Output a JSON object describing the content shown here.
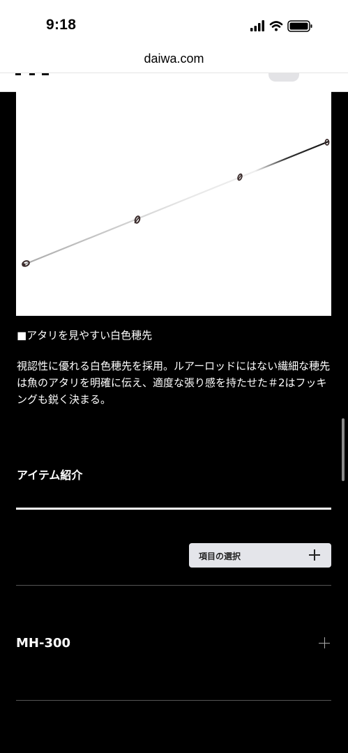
{
  "status_bar": {
    "time": "9:18",
    "icons": [
      "cellular-signal-icon",
      "wifi-icon",
      "battery-icon"
    ]
  },
  "browser": {
    "url": "daiwa.com"
  },
  "product": {
    "image_subject": "rod-tip-icon",
    "caption": "■アタリを見やすい白色穂先",
    "description": "視認性に優れる白色穂先を採用。ルアーロッドにはない繊細な穂先は魚のアタリを明確に伝え、適度な張り感を持たせた＃2はフッキングも鋭く決まる。"
  },
  "items_section": {
    "heading": "アイテム紹介",
    "select_button_label": "項目の選択",
    "items": [
      {
        "label": "MH-300"
      }
    ]
  },
  "colors": {
    "background": "#000000",
    "text": "#ffffff",
    "button_bg": "#e4e5ea"
  }
}
